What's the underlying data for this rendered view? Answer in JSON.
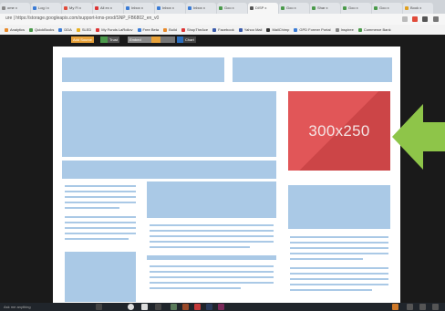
{
  "browser": {
    "tabs": [
      "ome x",
      "Log i x",
      "My Fi x",
      "All ex x",
      "Inbox x",
      "Inbox x",
      "Inbox x",
      "Goo x",
      "DISP x",
      "Goo x",
      "Shar x",
      "Goo x",
      "Goo x",
      "Book x"
    ],
    "active_tab_index": 8,
    "address": "ure | https://storage.googleapis.com/support-kms-prod/SNP_FB6802_en_v0",
    "bookmarks": [
      "Analytics",
      "QuickBooks",
      "DDA",
      "SLED",
      "My Funds LaRollov",
      "Free Beta",
      "Build",
      "ShopTheAce",
      "Facebook",
      "Yahoo Mail",
      "MailChimp",
      "GPD Former Portal",
      "Inspiree",
      "Commerce Bank"
    ]
  },
  "page_toolbar": {
    "button_label": "Add Source",
    "fields": [
      "Trust",
      "Embed",
      "",
      "",
      "Chart"
    ]
  },
  "ad": {
    "label": "300x250",
    "color": "#e15658",
    "shade": "#cc4547"
  },
  "arrow": {
    "color": "#8ec549"
  },
  "layout_color": "#aac9e6",
  "taskbar": {
    "search": "Ask me anything"
  }
}
